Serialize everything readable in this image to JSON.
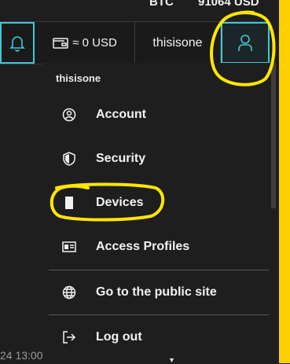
{
  "ticker": {
    "symbol": "BTC",
    "price": "91064 USD"
  },
  "topbar": {
    "bell_icon": "bell-icon",
    "wallet_icon": "wallet-icon",
    "balance": "≈ 0 USD",
    "username": "thisisone",
    "user_icon": "user-icon"
  },
  "menu": {
    "username": "thisisone",
    "items": [
      {
        "label": "Account",
        "icon": "account-circle-icon"
      },
      {
        "label": "Security",
        "icon": "shield-icon"
      },
      {
        "label": "Devices",
        "icon": "device-icon"
      },
      {
        "label": "Access Profiles",
        "icon": "id-card-icon"
      },
      {
        "label": "Go to the public site",
        "icon": "globe-icon"
      },
      {
        "label": "Log out",
        "icon": "logout-icon"
      }
    ]
  },
  "footer": {
    "timestamp": "24 13:00"
  },
  "colors": {
    "accent": "#43c6d6",
    "highlight": "#ffd000",
    "background": "#1e1e1e"
  }
}
